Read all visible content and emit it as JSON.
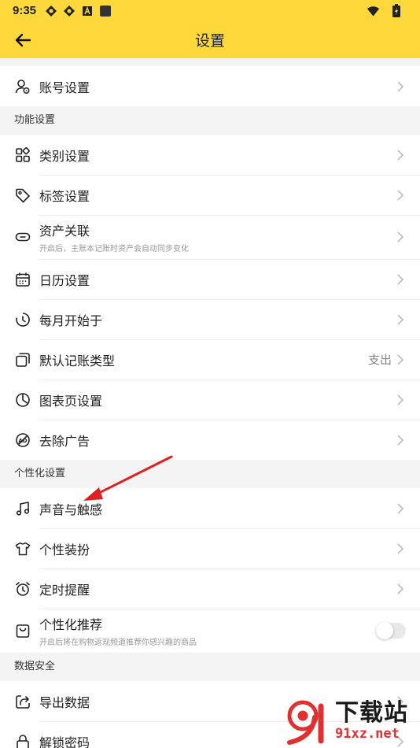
{
  "status_bar": {
    "time": "9:35"
  },
  "app_bar": {
    "title": "设置"
  },
  "account": {
    "label": "账号设置"
  },
  "sections": {
    "features": {
      "header": "功能设置",
      "items": [
        {
          "label": "类别设置"
        },
        {
          "label": "标签设置"
        },
        {
          "label": "资产关联",
          "sub": "开启后，主账本记账时资产会自动同步变化"
        },
        {
          "label": "日历设置"
        },
        {
          "label": "每月开始于"
        },
        {
          "label": "默认记账类型",
          "value": "支出"
        },
        {
          "label": "图表页设置"
        },
        {
          "label": "去除广告"
        }
      ]
    },
    "personal": {
      "header": "个性化设置",
      "items": [
        {
          "label": "声音与触感"
        },
        {
          "label": "个性装扮"
        },
        {
          "label": "定时提醒"
        },
        {
          "label": "个性化推荐",
          "sub": "开启后将在购物返现频道推荐你感兴趣的商品",
          "toggle_on": false
        }
      ]
    },
    "security": {
      "header": "数据安全",
      "items": [
        {
          "label": "导出数据"
        },
        {
          "label": "解锁密码"
        }
      ]
    }
  },
  "watermark": {
    "title": "下载站",
    "url": "91xz.net"
  },
  "colors": {
    "accent": "#ffd83b",
    "arrow": "#e02020"
  }
}
